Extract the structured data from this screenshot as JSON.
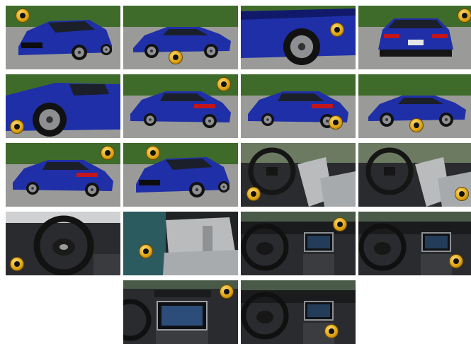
{
  "gallery": {
    "rows": [
      [
        {
          "name": "photo-front-quarter",
          "kind": "ext-front"
        },
        {
          "name": "photo-side-profile",
          "kind": "ext-side"
        },
        {
          "name": "photo-wheel-closeup",
          "kind": "ext-wheel"
        },
        {
          "name": "photo-rear",
          "kind": "ext-rear"
        }
      ],
      [
        {
          "name": "photo-front-fender",
          "kind": "ext-fender"
        },
        {
          "name": "photo-rear-quarter",
          "kind": "ext-rear3q"
        },
        {
          "name": "photo-rear-left",
          "kind": "ext-rear3q"
        },
        {
          "name": "photo-side-far",
          "kind": "ext-side"
        }
      ],
      [
        {
          "name": "photo-rear-quarter-2",
          "kind": "ext-rear3q"
        },
        {
          "name": "photo-front-quarter-2",
          "kind": "ext-front"
        },
        {
          "name": "photo-driver-seat",
          "kind": "int-seat"
        },
        {
          "name": "photo-driver-seat-2",
          "kind": "int-seat"
        }
      ],
      [
        {
          "name": "photo-steering-wheel",
          "kind": "int-wheel"
        },
        {
          "name": "photo-rear-seat",
          "kind": "int-rear"
        },
        {
          "name": "photo-dashboard",
          "kind": "int-dash"
        },
        {
          "name": "photo-center-console",
          "kind": "int-dash"
        }
      ],
      [
        {
          "name": "photo-infotainment",
          "kind": "int-screen"
        },
        {
          "name": "photo-dashboard-wide",
          "kind": "int-dash"
        }
      ]
    ]
  },
  "colors": {
    "car_blue": "#1f2fa8",
    "car_blue_dark": "#111a6a",
    "asphalt": "#9a9a98",
    "foliage": "#3f6b2a",
    "sky": "#dfe6ea",
    "interior_dark": "#2a2b2e",
    "interior_light": "#b9bbbd",
    "badge_gold": "#e2a614"
  }
}
